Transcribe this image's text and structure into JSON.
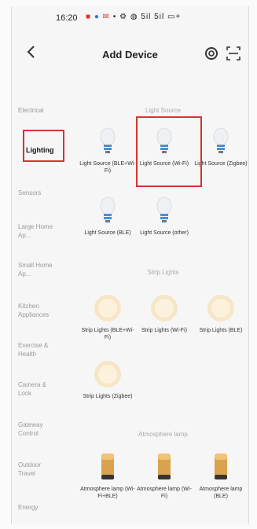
{
  "status_bar": {
    "time": "16:20",
    "signal_text": "5il 5il",
    "icons": [
      "notification-icon",
      "bluetooth-icon",
      "wifi-icon",
      "battery-icon"
    ]
  },
  "header": {
    "title": "Add Device",
    "back_icon": "back-arrow-icon",
    "right_icons": [
      "auto-scan-icon",
      "qr-scan-icon"
    ]
  },
  "sidebar": {
    "items": [
      {
        "label": "Electrical",
        "active": false
      },
      {
        "label": "Lighting",
        "active": true
      },
      {
        "label": "Sensors",
        "active": false
      },
      {
        "label": "Large Home Ap...",
        "active": false
      },
      {
        "label": "Small Home Ap...",
        "active": false
      },
      {
        "label": "Kitchen Appliances",
        "active": false
      },
      {
        "label": "Exercise & Health",
        "active": false
      },
      {
        "label": "Camera & Lock",
        "active": false
      },
      {
        "label": "Gateway Control",
        "active": false
      },
      {
        "label": "Outdoor Travel",
        "active": false
      },
      {
        "label": "Energy",
        "active": false
      }
    ]
  },
  "sections": {
    "light_source": {
      "title": "Light Source",
      "items": [
        {
          "label": "Light Source (BLE+Wi-Fi)",
          "icon": "bulb-icon"
        },
        {
          "label": "Light Source (Wi-Fi)",
          "icon": "bulb-icon"
        },
        {
          "label": "Light Source (Zigbee)",
          "icon": "bulb-icon"
        },
        {
          "label": "Light Source (BLE)",
          "icon": "bulb-icon"
        },
        {
          "label": "Light Source (other)",
          "icon": "bulb-icon"
        }
      ]
    },
    "strip_lights": {
      "title": "Strip Lights",
      "items": [
        {
          "label": "Strip Lights (BLE+Wi-Fi)",
          "icon": "strip-light-icon"
        },
        {
          "label": "Strip Lights (Wi-Fi)",
          "icon": "strip-light-icon"
        },
        {
          "label": "Strip Lights (BLE)",
          "icon": "strip-light-icon"
        },
        {
          "label": "Strip Lights (Zigbee)",
          "icon": "strip-light-icon"
        }
      ]
    },
    "atmosphere_lamp": {
      "title": "Atmosphere lamp",
      "items": [
        {
          "label": "Atmosphere lamp (Wi-Fi+BLE)",
          "icon": "atmosphere-lamp-icon"
        },
        {
          "label": "Atmosphere lamp (Wi-Fi)",
          "icon": "atmosphere-lamp-icon"
        },
        {
          "label": "Atmosphere lamp (BLE)",
          "icon": "atmosphere-lamp-icon"
        }
      ]
    }
  },
  "colors": {
    "highlight": "#d63232",
    "background": "#f6f6f6"
  }
}
